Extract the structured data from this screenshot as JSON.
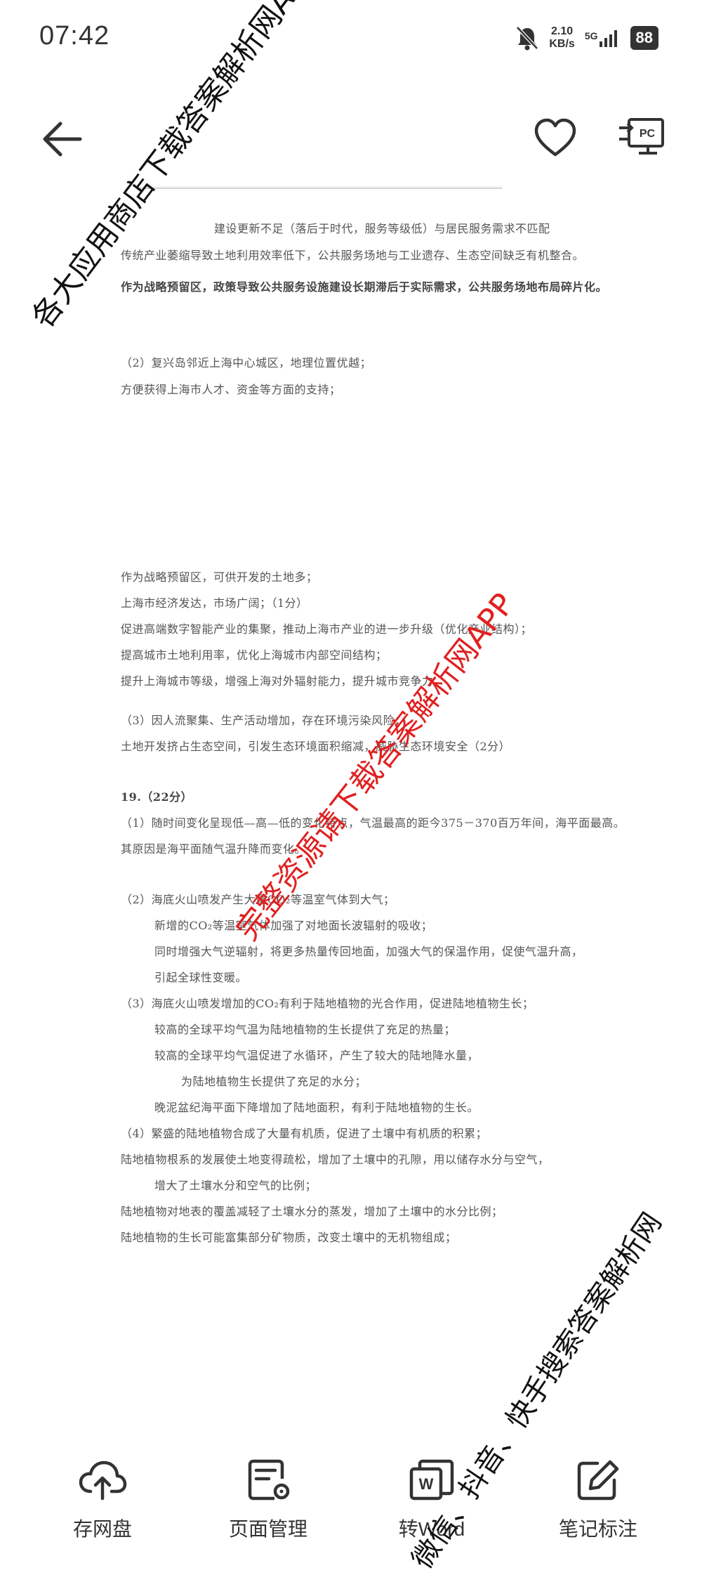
{
  "status": {
    "time": "07:42",
    "net_speed_value": "2.10",
    "net_speed_unit": "KB/s",
    "network": "5G",
    "battery": "88"
  },
  "nav": {
    "back_icon": "back-arrow-icon",
    "favorite_icon": "heart-icon",
    "pc_icon": "send-to-pc-icon",
    "pc_text": "PC"
  },
  "doc": {
    "lines": [
      "建设更新不足（落后于时代，服务等级低）与居民服务需求不匹配",
      "传统产业萎缩导致土地利用效率低下，公共服务场地与工业遗存、生态空间缺乏有机整合。",
      "作为战略预留区，政策导致公共服务设施建设长期滞后于实际需求，公共服务场地布局碎片化。",
      "（2）复兴岛邻近上海中心城区，地理位置优越；",
      "方便获得上海市人才、资金等方面的支持；",
      "作为战略预留区，可供开发的土地多；",
      "上海市经济发达，市场广阔；（1分）",
      "促进高端数字智能产业的集聚，推动上海市产业的进一步升级（优化产业结构）；",
      "提高城市土地利用率，优化上海城市内部空间结构；",
      "提升上海城市等级，增强上海对外辐射能力，提升城市竞争力。",
      "（3）因人流聚集、生产活动增加，存在环境污染风险；",
      "土地开发挤占生态空间，引发生态环境面积缩减，威胁生态环境安全（2分）",
      "19.（22分）",
      "（1）随时间变化呈现低—高—低的变化特点，气温最高的距今375－370百万年间，海平面最高。",
      "其原因是海平面随气温升降而变化。",
      "（2）海底火山喷发产生大量CO₂等温室气体到大气；",
      "新增的CO₂等温室气体加强了对地面长波辐射的吸收；",
      "同时增强大气逆辐射，将更多热量传回地面，加强大气的保温作用，促使气温升高，",
      "引起全球性变暖。",
      "（3）海底火山喷发增加的CO₂有利于陆地植物的光合作用，促进陆地植物生长；",
      "较高的全球平均气温为陆地植物的生长提供了充足的热量；",
      "较高的全球平均气温促进了水循环，产生了较大的陆地降水量，",
      "为陆地植物生长提供了充足的水分；",
      "晚泥盆纪海平面下降增加了陆地面积，有利于陆地植物的生长。",
      "（4）繁盛的陆地植物合成了大量有机质，促进了土壤中有机质的积累；",
      "陆地植物根系的发展使土地变得疏松，增加了土壤中的孔隙，用以储存水分与空气，",
      "增大了土壤水分和空气的比例；",
      "陆地植物对地表的覆盖减轻了土壤水分的蒸发，增加了土壤中的水分比例；",
      "陆地植物的生长可能富集部分矿物质，改变土壤中的无机物组成；"
    ]
  },
  "watermarks": {
    "top": "各大应用商店下载答案解析网APP",
    "center": "完整资源请下载答案解析网APP",
    "bottom": "微信、抖音、快手搜索答案解析网"
  },
  "toolbar": {
    "cloud_label": "存网盘",
    "page_label": "页面管理",
    "word_label": "转Word",
    "note_label": "笔记标注"
  }
}
